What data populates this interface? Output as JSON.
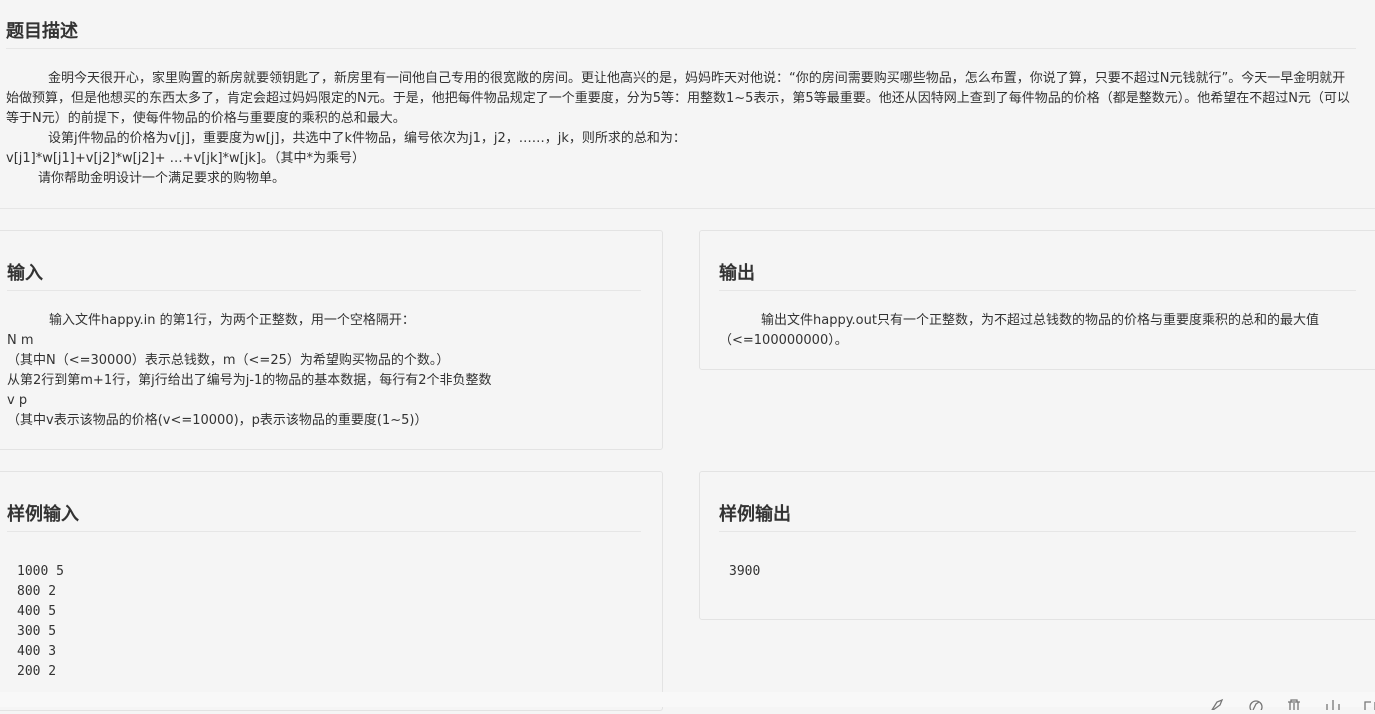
{
  "description": {
    "title": "题目描述",
    "paragraph_1": "金明今天很开心，家里购置的新房就要领钥匙了，新房里有一间他自己专用的很宽敞的房间。更让他高兴的是，妈妈昨天对他说：“你的房间需要购买哪些物品，怎么布置，你说了算，只要不超过N元钱就行”。今天一早金明就开始做预算，但是他想买的东西太多了，肯定会超过妈妈限定的N元。于是，他把每件物品规定了一个重要度，分为5等：用整数1~5表示，第5等最重要。他还从因特网上查到了每件物品的价格（都是整数元）。他希望在不超过N元（可以等于N元）的前提下，使每件物品的价格与重要度的乘积的总和最大。",
    "paragraph_2": "设第j件物品的价格为v[j]，重要度为w[j]，共选中了k件物品，编号依次为j1，j2，……，jk，则所求的总和为：",
    "formula": "v[j1]*w[j1]+v[j2]*w[j2]+ …+v[jk]*w[jk]。（其中*为乘号）",
    "request": "请你帮助金明设计一个满足要求的购物单。"
  },
  "input": {
    "title": "输入",
    "lines": [
      "输入文件happy.in 的第1行，为两个正整数，用一个空格隔开：",
      "N m",
      "（其中N（<=30000）表示总钱数，m（<=25）为希望购买物品的个数。）",
      "从第2行到第m+1行，第j行给出了编号为j-1的物品的基本数据，每行有2个非负整数",
      "v p",
      "（其中v表示该物品的价格(v<=10000)，p表示该物品的重要度(1~5)）"
    ]
  },
  "output": {
    "title": "输出",
    "text": "输出文件happy.out只有一个正整数，为不超过总钱数的物品的价格与重要度乘积的总和的最大值（<=100000000）。"
  },
  "sample_input": {
    "title": "样例输入",
    "content": "1000 5\n800 2\n400 5\n300 5\n400 3\n200 2"
  },
  "sample_output": {
    "title": "样例输出",
    "content": "3900"
  },
  "toolbar": {
    "icons": [
      "rocket-icon",
      "copy-icon",
      "trash-icon",
      "split-view-icon",
      "fullscreen-icon"
    ]
  }
}
